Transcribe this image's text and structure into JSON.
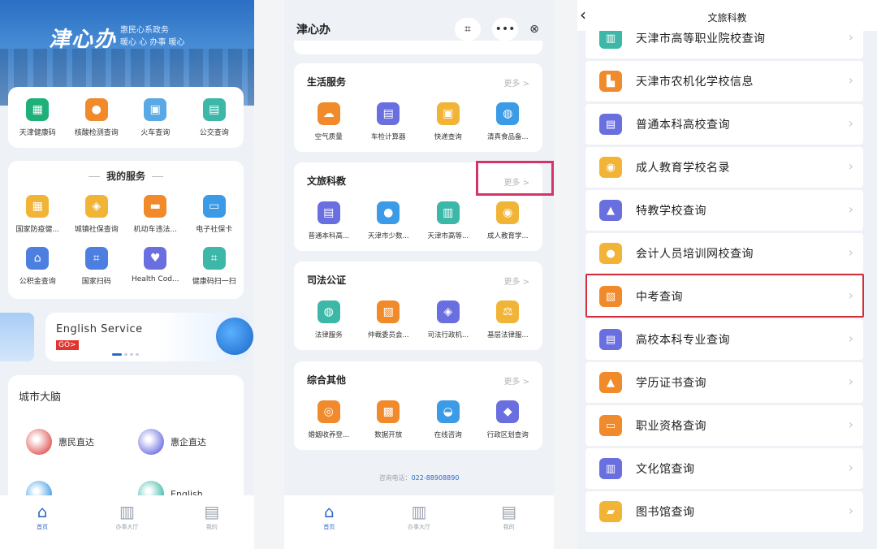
{
  "colors": {
    "accent": "#2e68c5",
    "highlight_pink": "#d7336b",
    "highlight_red": "#d22e3a"
  },
  "screen1": {
    "logo": "津心办",
    "tagline": [
      "惠民心系政务",
      "暖心 心 办事 暖心"
    ],
    "quick": [
      {
        "label": "天津健康码",
        "icon": "qr-code-icon",
        "color": "#1fb07a"
      },
      {
        "label": "核酸检测查询",
        "icon": "person-icon",
        "color": "#f08a2b"
      },
      {
        "label": "火车查询",
        "icon": "train-icon",
        "color": "#5aa9e6"
      },
      {
        "label": "公交查询",
        "icon": "bus-icon",
        "color": "#3cb7a8"
      }
    ],
    "my_service_title": "我的服务",
    "my_services": [
      {
        "label": "国家防疫健...",
        "icon": "grid-icon",
        "color": "#f2b437"
      },
      {
        "label": "城镇社保查询",
        "icon": "shield-icon",
        "color": "#f2b437"
      },
      {
        "label": "机动车违法...",
        "icon": "car-icon",
        "color": "#f08a2b"
      },
      {
        "label": "电子社保卡",
        "icon": "card-icon",
        "color": "#3c9be6"
      },
      {
        "label": "公积金查询",
        "icon": "house-icon",
        "color": "#4d7fe0"
      },
      {
        "label": "国家扫码",
        "icon": "scan-icon",
        "color": "#4d7fe0"
      },
      {
        "label": "Health Cod...",
        "icon": "health-icon",
        "color": "#6a6fe0"
      },
      {
        "label": "健康码扫一扫",
        "icon": "scan-icon",
        "color": "#3cb7a8"
      }
    ],
    "english_service": {
      "title": "English  Service",
      "badge": "GO>"
    },
    "city": {
      "title": "城市大脑",
      "items": [
        {
          "label": "惠民直达",
          "color": "#e05555"
        },
        {
          "label": "惠企直达",
          "color": "#6a6fe0"
        },
        {
          "label": "",
          "color": "#3c9be6"
        },
        {
          "label": "English",
          "color": "#3cb7a8"
        }
      ]
    },
    "tabs": [
      {
        "label": "首页",
        "icon": "home-icon"
      },
      {
        "label": "办事大厅",
        "icon": "hall-icon"
      },
      {
        "label": "我的",
        "icon": "store-icon"
      }
    ]
  },
  "screen2": {
    "title": "津心办",
    "more": "更多 >",
    "sections": [
      {
        "title": "生活服务",
        "items": [
          {
            "label": "空气质量",
            "icon": "cloud-icon",
            "color": "#f08a2b"
          },
          {
            "label": "车检计算器",
            "icon": "bus-icon",
            "color": "#6a6fe0"
          },
          {
            "label": "快递查询",
            "icon": "box-icon",
            "color": "#f2b437"
          },
          {
            "label": "清真食品备...",
            "icon": "globe-icon",
            "color": "#3c9be6"
          }
        ]
      },
      {
        "title": "文旅科教",
        "items": [
          {
            "label": "普通本科高...",
            "icon": "book-icon",
            "color": "#6a6fe0"
          },
          {
            "label": "天津市少数...",
            "icon": "person-icon",
            "color": "#3c9be6"
          },
          {
            "label": "天津市高等...",
            "icon": "building-icon",
            "color": "#3cb7a8"
          },
          {
            "label": "成人教育学...",
            "icon": "coin-icon",
            "color": "#f2b437"
          }
        ]
      },
      {
        "title": "司法公证",
        "items": [
          {
            "label": "法律服务",
            "icon": "globe-icon",
            "color": "#3cb7a8"
          },
          {
            "label": "仲裁委员会...",
            "icon": "doc-icon",
            "color": "#f08a2b"
          },
          {
            "label": "司法行政机...",
            "icon": "shield-icon",
            "color": "#6a6fe0"
          },
          {
            "label": "基层法律服...",
            "icon": "scale-icon",
            "color": "#f2b437"
          }
        ]
      },
      {
        "title": "综合其他",
        "items": [
          {
            "label": "婚姻收养登...",
            "icon": "people-icon",
            "color": "#f08a2b"
          },
          {
            "label": "数据开放",
            "icon": "data-icon",
            "color": "#f08a2b"
          },
          {
            "label": "在线咨询",
            "icon": "chat-icon",
            "color": "#3c9be6"
          },
          {
            "label": "行政区划查询",
            "icon": "map-icon",
            "color": "#6a6fe0"
          }
        ]
      }
    ],
    "consult_phone_label": "咨询电话：",
    "consult_phone": "022-88908890",
    "tabs": [
      {
        "label": "首页",
        "icon": "home-icon"
      },
      {
        "label": "办事大厅",
        "icon": "hall-icon"
      },
      {
        "label": "我的",
        "icon": "store-icon"
      }
    ]
  },
  "screen3": {
    "title": "文旅科教",
    "items": [
      {
        "label": "天津市高等职业院校查询",
        "icon": "building-icon",
        "color": "#3cb7a8"
      },
      {
        "label": "天津市农机化学校信息",
        "icon": "tractor-icon",
        "color": "#f08a2b"
      },
      {
        "label": "普通本科高校查询",
        "icon": "book-icon",
        "color": "#6a6fe0"
      },
      {
        "label": "成人教育学校名录",
        "icon": "coin-icon",
        "color": "#f2b437"
      },
      {
        "label": "特教学校查询",
        "icon": "triangle-icon",
        "color": "#6a6fe0"
      },
      {
        "label": "会计人员培训网校查询",
        "icon": "person-icon",
        "color": "#f2b437"
      },
      {
        "label": "中考查询",
        "icon": "doc-icon",
        "color": "#f08a2b"
      },
      {
        "label": "高校本科专业查询",
        "icon": "book-icon",
        "color": "#6a6fe0"
      },
      {
        "label": "学历证书查询",
        "icon": "cap-icon",
        "color": "#f08a2b"
      },
      {
        "label": "职业资格查询",
        "icon": "card-icon",
        "color": "#f08a2b"
      },
      {
        "label": "文化馆查询",
        "icon": "hall-icon",
        "color": "#6a6fe0"
      },
      {
        "label": "图书馆查询",
        "icon": "open-book-icon",
        "color": "#f2b437"
      }
    ]
  }
}
